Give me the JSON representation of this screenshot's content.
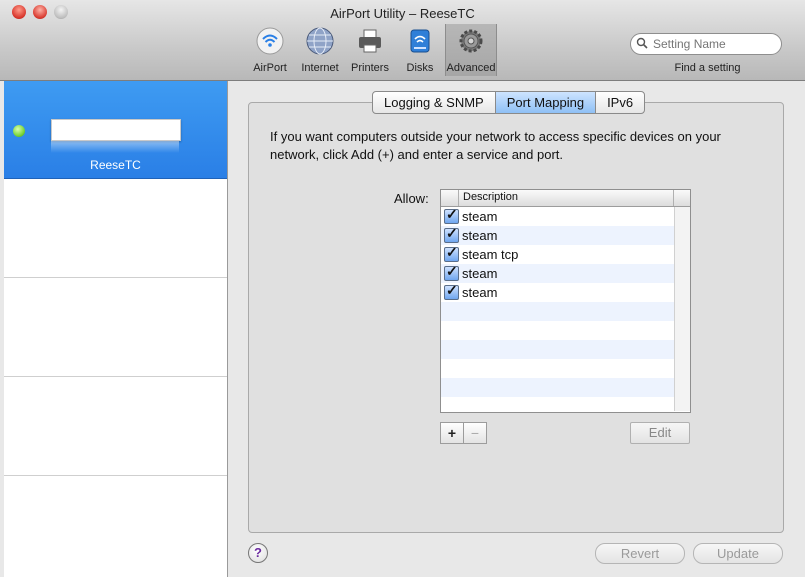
{
  "window": {
    "title": "AirPort Utility – ReeseTC"
  },
  "toolbar": {
    "items": [
      {
        "label": "AirPort",
        "icon": "airport-icon"
      },
      {
        "label": "Internet",
        "icon": "internet-icon"
      },
      {
        "label": "Printers",
        "icon": "printer-icon"
      },
      {
        "label": "Disks",
        "icon": "disk-icon"
      },
      {
        "label": "Advanced",
        "icon": "gear-icon",
        "selected": true
      }
    ]
  },
  "search": {
    "placeholder": "Setting Name",
    "caption": "Find a setting"
  },
  "sidebar": {
    "devices": [
      {
        "name": "ReeseTC",
        "status": "green"
      }
    ]
  },
  "tabs": [
    {
      "label": "Logging & SNMP"
    },
    {
      "label": "Port Mapping",
      "active": true
    },
    {
      "label": "IPv6"
    }
  ],
  "port_mapping": {
    "description": "If you want computers outside your network to access specific devices on your network, click Add (+) and enter a service and port.",
    "allow_label": "Allow:",
    "column_header": "Description",
    "rows": [
      {
        "checked": true,
        "name": "steam"
      },
      {
        "checked": true,
        "name": "steam"
      },
      {
        "checked": true,
        "name": "steam tcp"
      },
      {
        "checked": true,
        "name": "steam"
      },
      {
        "checked": true,
        "name": "steam"
      }
    ],
    "add_label": "+",
    "remove_label": "−",
    "edit_label": "Edit"
  },
  "footer": {
    "help_label": "?",
    "revert_label": "Revert",
    "update_label": "Update"
  },
  "colors": {
    "selection": "#2a7fe6",
    "active_tab": "#8ec0f5",
    "status_ok": "#7cd63a"
  }
}
